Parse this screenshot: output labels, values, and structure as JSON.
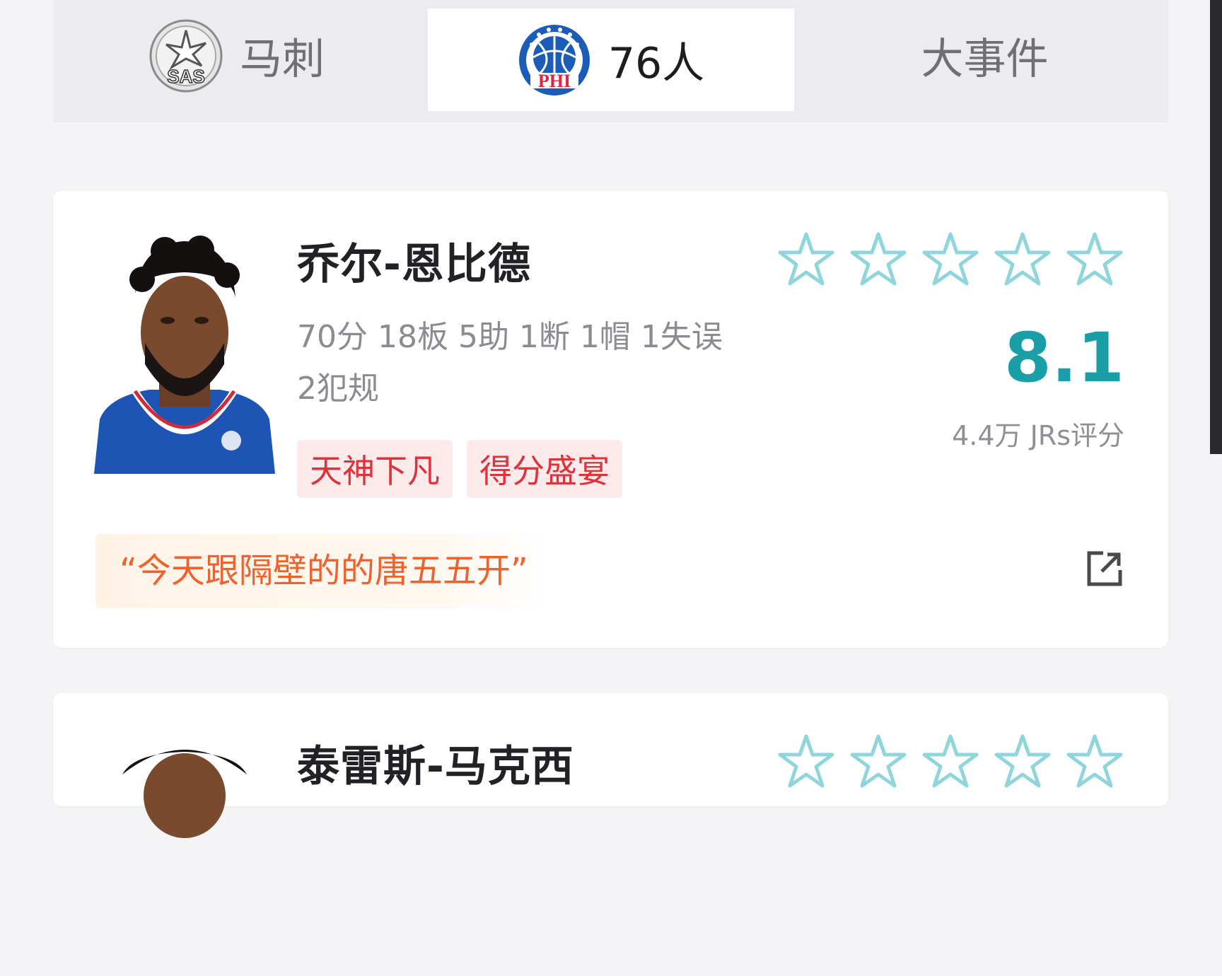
{
  "tabs": [
    {
      "label": "马刺",
      "logo": "spurs-logo"
    },
    {
      "label": "76人",
      "logo": "sixers-logo",
      "active": true
    },
    {
      "label": "大事件"
    }
  ],
  "colors": {
    "accent": "#1a9ea8",
    "star": "#8fd6dc",
    "tag_text": "#e0323a",
    "quote_text": "#f0622d"
  },
  "players": [
    {
      "name": "乔尔-恩比德",
      "stats": "70分 18板 5助 1断 1帽 1失误 2犯规",
      "tags": [
        "天神下凡",
        "得分盛宴"
      ],
      "rating_stars": 0,
      "score": "8.1",
      "votes": "4.4万 JRs评分",
      "quote": "“今天跟隔壁的的唐五五开”"
    },
    {
      "name": "泰雷斯-马克西",
      "rating_stars": 0
    }
  ]
}
